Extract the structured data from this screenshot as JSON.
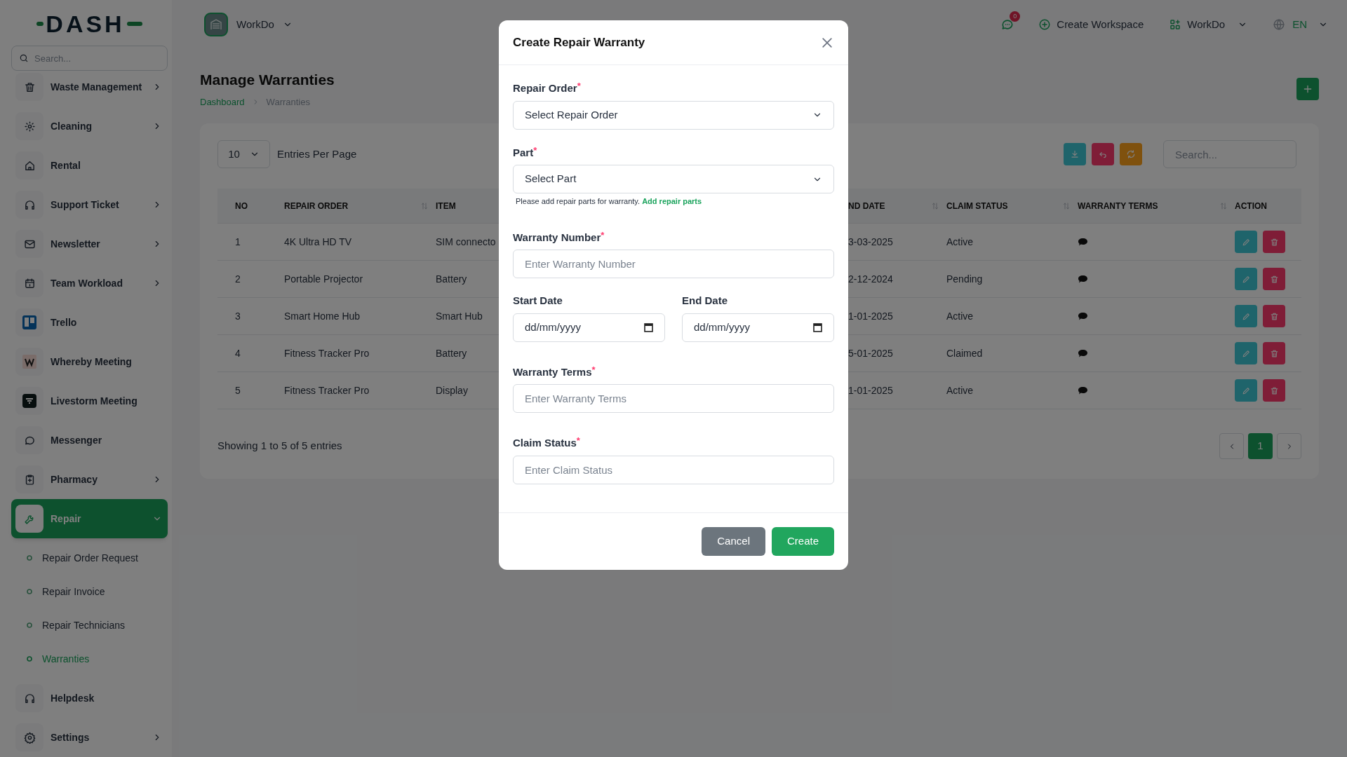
{
  "logo": "DASH",
  "sidebar": {
    "search": {
      "placeholder": "Search..."
    },
    "items": [
      {
        "label": "Waste Management",
        "expanded": false,
        "selected": false
      },
      {
        "label": "Cleaning",
        "expanded": false,
        "selected": false
      },
      {
        "label": "Rental",
        "selected": false
      },
      {
        "label": "Support Ticket",
        "expanded": false,
        "selected": false
      },
      {
        "label": "Newsletter",
        "expanded": false,
        "selected": false
      },
      {
        "label": "Team Workload",
        "expanded": false,
        "selected": false
      },
      {
        "label": "Trello",
        "selected": false
      },
      {
        "label": "Whereby Meeting",
        "selected": false
      },
      {
        "label": "Livestorm Meeting",
        "selected": false
      },
      {
        "label": "Messenger",
        "selected": false
      },
      {
        "label": "Pharmacy",
        "expanded": false,
        "selected": false
      },
      {
        "label": "Repair",
        "expanded": true,
        "selected": true,
        "children": [
          {
            "label": "Repair Order Request",
            "selected": false
          },
          {
            "label": "Repair Invoice",
            "selected": false
          },
          {
            "label": "Repair Technicians",
            "selected": false
          },
          {
            "label": "Warranties",
            "selected": true
          }
        ]
      },
      {
        "label": "Helpdesk",
        "selected": false
      },
      {
        "label": "Settings",
        "expanded": false,
        "selected": false
      }
    ]
  },
  "topbar": {
    "workspace": "WorkDo",
    "notifications": "0",
    "create_workspace": "Create Workspace",
    "account": "WorkDo",
    "language": "EN"
  },
  "page": {
    "title": "Manage Warranties",
    "breadcrumb": [
      {
        "label": "Dashboard",
        "link": true
      },
      {
        "label": "Warranties",
        "link": false
      }
    ]
  },
  "table_card": {
    "entries": "10",
    "entries_label": "Entries Per Page",
    "search": {
      "placeholder": "Search..."
    },
    "columns": [
      {
        "label": "NO",
        "sortable": false
      },
      {
        "label": "REPAIR ORDER",
        "sortable": true
      },
      {
        "label": "ITEM",
        "sortable": false
      },
      {
        "label": "ND DATE",
        "sortable": true
      },
      {
        "label": "CLAIM STATUS",
        "sortable": true
      },
      {
        "label": "WARRANTY TERMS",
        "sortable": true
      },
      {
        "label": "ACTION",
        "sortable": false
      }
    ],
    "rows": [
      {
        "no": "1",
        "repair_order": "4K Ultra HD TV",
        "item": "SIM connecto",
        "end_date": "3-03-2025",
        "claim_status": "Active"
      },
      {
        "no": "2",
        "repair_order": "Portable Projector",
        "item": "Battery",
        "end_date": "2-12-2024",
        "claim_status": "Pending"
      },
      {
        "no": "3",
        "repair_order": "Smart Home Hub",
        "item": "Smart Hub",
        "end_date": "1-01-2025",
        "claim_status": "Active"
      },
      {
        "no": "4",
        "repair_order": "Fitness Tracker Pro",
        "item": "Battery",
        "end_date": "5-01-2025",
        "claim_status": "Claimed"
      },
      {
        "no": "5",
        "repair_order": "Fitness Tracker Pro",
        "item": "Display",
        "end_date": "1-01-2025",
        "claim_status": "Active"
      }
    ],
    "footer": "Showing 1 to 5 of 5 entries",
    "pages": [
      {
        "label": "1",
        "selected": true
      }
    ]
  },
  "modal": {
    "title": "Create Repair Warranty",
    "fields": [
      {
        "kind": "select",
        "label": "Repair Order",
        "required_mark": "*",
        "value": "Select Repair Order"
      },
      {
        "kind": "select",
        "label": "Part",
        "required_mark": "*",
        "value": "Select Part",
        "help": "Please add repair parts for warranty.",
        "help_link": "Add repair parts"
      },
      {
        "kind": "text",
        "label": "Warranty Number",
        "required_mark": "*",
        "placeholder": "Enter Warranty Number"
      },
      {
        "kind": "dates",
        "dates": [
          {
            "label": "Start Date",
            "value": "dd/mm/yyyy"
          },
          {
            "label": "End Date",
            "value": "dd/mm/yyyy"
          }
        ]
      },
      {
        "kind": "text",
        "label": "Warranty Terms",
        "required_mark": "*",
        "placeholder": "Enter Warranty Terms"
      },
      {
        "kind": "text",
        "label": "Claim Status",
        "required_mark": "*",
        "placeholder": "Enter Claim Status"
      }
    ],
    "buttons": [
      {
        "label": "Cancel",
        "kind": "secondary"
      },
      {
        "label": "Create",
        "kind": "primary"
      }
    ]
  }
}
